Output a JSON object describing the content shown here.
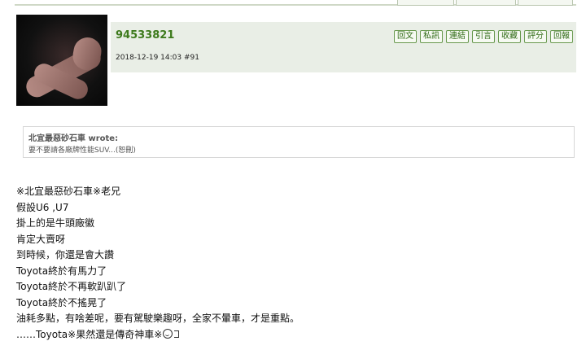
{
  "post": {
    "username": "94533821",
    "meta": "2018-12-19 14:03  #91",
    "actions": [
      "回文",
      "私訊",
      "連結",
      "引言",
      "收藏",
      "評分",
      "回報"
    ],
    "quote": {
      "author": "北宜最惡砂石車 wrote:",
      "text": "要不要請各廠牌性能SUV...(恕刪)"
    },
    "body_lines": [
      "※北宜最惡砂石車※老兄",
      "假設U6 ,U7",
      "掛上的是牛頭廠徽",
      "肯定大賣呀",
      "到時候，你還是會大讚",
      "Toyota終於有馬力了",
      "Toyota終於不再軟趴趴了",
      "Toyota終於不搖晃了",
      "油耗多點，有啥差呢，要有駕駛樂趣呀，全家不暈車，才是重點。",
      "……Toyota※果然還是傳奇神車※"
    ]
  },
  "icons": {
    "emoticon": "smiley-icon"
  }
}
